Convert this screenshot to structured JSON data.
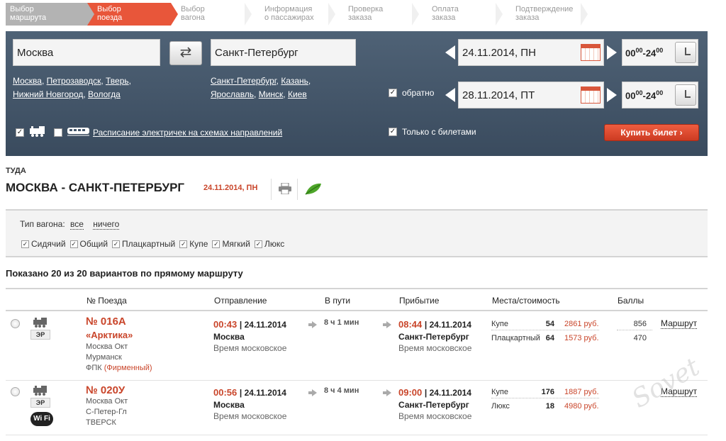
{
  "steps": [
    {
      "line1": "Выбор",
      "line2": "маршрута",
      "state": "done"
    },
    {
      "line1": "Выбор",
      "line2": "поезда",
      "state": "active"
    },
    {
      "line1": "Выбор",
      "line2": "вагона",
      "state": "todo"
    },
    {
      "line1": "Информация",
      "line2": "о пассажирах",
      "state": "todo"
    },
    {
      "line1": "Проверка",
      "line2": "заказа",
      "state": "todo"
    },
    {
      "line1": "Оплата",
      "line2": "заказа",
      "state": "todo"
    },
    {
      "line1": "Подтверждение",
      "line2": "заказа",
      "state": "todo"
    }
  ],
  "search": {
    "from": "Москва",
    "to": "Санкт-Петербург",
    "swap_icon": "⇄",
    "from_suggestions": [
      "Москва",
      "Петрозаводск",
      "Тверь",
      "Нижний Новгород",
      "Вологда"
    ],
    "to_suggestions": [
      "Санкт-Петербург",
      "Казань",
      "Ярославль",
      "Минск",
      "Киев"
    ],
    "date_there": "24.11.2014, ПН",
    "date_back": "28.11.2014, ПТ",
    "time_from": "00",
    "time_sup1": "00",
    "time_to": "-24",
    "time_sup2": "00",
    "return_label": "обратно",
    "return_checked": true,
    "only_tickets_label": "Только с билетами",
    "only_tickets_checked": true,
    "train_checked": true,
    "suburban_checked": false,
    "schedule_link": "Расписание электричек на схемах направлений",
    "buy_button": "Купить билет"
  },
  "direction": {
    "label": "ТУДА",
    "title": "МОСКВА - САНКТ-ПЕТЕРБУРГ",
    "date": "24.11.2014, ПН"
  },
  "filter": {
    "wagon_type_label": "Тип вагона:",
    "all_link": "все",
    "none_link": "ничего",
    "types": [
      "Сидячий",
      "Общий",
      "Плацкартный",
      "Купе",
      "Мягкий",
      "Люкс"
    ]
  },
  "shown_text": "Показано 20 из 20 вариантов по прямому маршруту",
  "table": {
    "headers": {
      "train_no": "№ Поезда",
      "departure": "Отправление",
      "travel": "В пути",
      "arrival": "Прибытие",
      "seats": "Места/стоимость",
      "points": "Баллы"
    },
    "rows": [
      {
        "number": "№ 016А",
        "name": "«Арктика»",
        "badge": "ЭР",
        "info1": "Москва Окт",
        "info2": "Мурманск",
        "carrier": "ФПК",
        "carrier_note": "(Фирменный)",
        "dep_time": "00:43",
        "dep_date": "| 24.11.2014",
        "dep_station": "Москва",
        "dep_tz": "Время московское",
        "duration": "8 ч 1 мин",
        "arr_time": "08:44",
        "arr_date": "| 24.11.2014",
        "arr_station": "Санкт-Петербург",
        "arr_tz": "Время московское",
        "seats": [
          {
            "type": "Купе",
            "count": "54",
            "price": "2861 руб.",
            "points": "856"
          },
          {
            "type": "Плацкартный",
            "count": "64",
            "price": "1573 руб.",
            "points": "470"
          }
        ],
        "route_link": "Маршрут"
      },
      {
        "number": "№ 020У",
        "badge": "ЭР",
        "wifi": "Wi Fi",
        "info1": "Москва Окт",
        "info2": "С-Петер-Гл",
        "carrier": "ТВЕРСК",
        "dep_time": "00:56",
        "dep_date": "| 24.11.2014",
        "dep_station": "Москва",
        "dep_tz": "Время московское",
        "duration": "8 ч 4 мин",
        "arr_time": "09:00",
        "arr_date": "| 24.11.2014",
        "arr_station": "Санкт-Петербург",
        "arr_tz": "Время московское",
        "seats": [
          {
            "type": "Купе",
            "count": "176",
            "price": "1887 руб."
          },
          {
            "type": "Люкс",
            "count": "18",
            "price": "4980 руб."
          }
        ],
        "route_link": "Маршрут"
      }
    ]
  },
  "watermark": "Sovet",
  "colors": {
    "accent": "#e8563a",
    "panel": "#45576b",
    "price": "#c9452a"
  }
}
